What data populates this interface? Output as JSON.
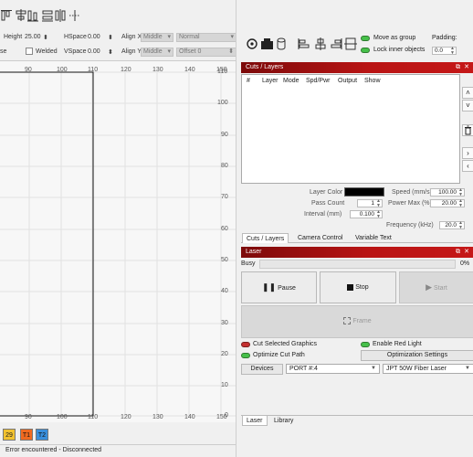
{
  "toolbar": {
    "icons": [
      "align-top-icon",
      "align-middle-icon",
      "align-bottom-icon",
      "distribute-horizontal-icon",
      "distribute-vertical-icon"
    ]
  },
  "properties": {
    "height_label": "Height",
    "height_value": "25.00",
    "hspace_label": "HSpace",
    "hspace_value": "0.00",
    "align_x_label": "Align X",
    "align_x_value": "Middle",
    "normal_value": "Normal",
    "se_label": "se",
    "welded_label": "Welded",
    "vspace_label": "VSpace",
    "vspace_value": "0.00",
    "align_y_label": "Align Y",
    "align_y_value": "Middle",
    "offset_label": "Offset",
    "offset_value": "0"
  },
  "canvas": {
    "top_ruler": [
      "80",
      "90",
      "100",
      "110",
      "120",
      "130",
      "140",
      "150"
    ],
    "bottom_ruler": [
      "80",
      "90",
      "100",
      "110",
      "120",
      "130",
      "140",
      "150"
    ],
    "right_ruler": [
      "110",
      "100",
      "90",
      "80",
      "70",
      "60",
      "50",
      "40",
      "30",
      "20",
      "10",
      "0"
    ]
  },
  "right_toolbar": {
    "move_as_group": "Move as group",
    "lock_inner": "Lock inner objects",
    "padding_label": "Padding:",
    "padding_value": "0.0"
  },
  "cuts_panel": {
    "title": "Cuts / Layers",
    "columns": [
      "#",
      "Layer",
      "Mode",
      "Spd/Pwr",
      "Output",
      "Show"
    ],
    "layer_color_label": "Layer Color",
    "pass_count_label": "Pass Count",
    "pass_count_value": "1",
    "interval_label": "Interval (mm)",
    "interval_value": "0.100",
    "speed_label": "Speed (mm/s)",
    "speed_value": "100.00",
    "power_label": "Power Max (%)",
    "power_value": "20.00",
    "frequency_label": "Frequency (kHz)",
    "frequency_value": "20.0",
    "layer_color": "#000000"
  },
  "mid_tabs": [
    "Cuts / Layers",
    "Camera Control",
    "Variable Text"
  ],
  "laser_panel": {
    "title": "Laser",
    "status": "Busy",
    "progress_text": "0%",
    "progress_fraction": 0,
    "pause_label": "Pause",
    "stop_label": "Stop",
    "start_label": "Start",
    "frame_label": "Frame",
    "cut_selected_label": "Cut Selected Graphics",
    "enable_red_light_label": "Enable Red Light",
    "optimize_cut_label": "Optimize Cut Path",
    "optimization_settings_label": "Optimization Settings",
    "devices_label": "Devices",
    "port_value": "PORT #:4",
    "device_value": "JPT 50W Fiber Laser"
  },
  "bottom_tabs": [
    "Laser",
    "Library"
  ],
  "status": {
    "badges": [
      "29",
      "T1",
      "T2"
    ],
    "message": "Error encountered - Disconnected"
  },
  "colors": {
    "accent_red": "#b91414",
    "toggle_on": "#46c04a",
    "toggle_off": "#c43030",
    "badge_yellow": "#f2c230",
    "badge_orange": "#f06a20",
    "badge_blue": "#3a8fdc"
  }
}
